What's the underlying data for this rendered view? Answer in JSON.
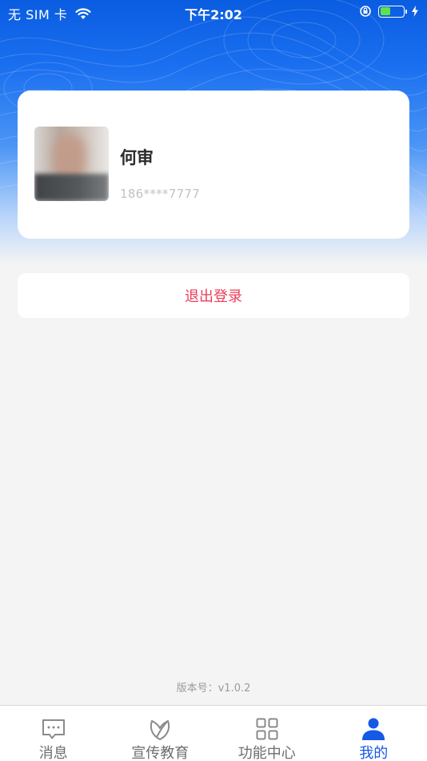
{
  "status_bar": {
    "carrier": "无 SIM 卡",
    "time": "下午2:02",
    "battery_level": 0.45
  },
  "profile": {
    "name": "何审",
    "phone": "186****7777"
  },
  "logout_label": "退出登录",
  "version_text": "版本号：v1.0.2",
  "tabs": [
    {
      "label": "消息",
      "icon": "message-icon",
      "active": false
    },
    {
      "label": "宣传教育",
      "icon": "leaf-icon",
      "active": false
    },
    {
      "label": "功能中心",
      "icon": "grid-icon",
      "active": false
    },
    {
      "label": "我的",
      "icon": "person-icon",
      "active": true
    }
  ],
  "colors": {
    "accent": "#1559e6",
    "logout_text": "#ec3d5a",
    "battery": "#5ee34a"
  }
}
